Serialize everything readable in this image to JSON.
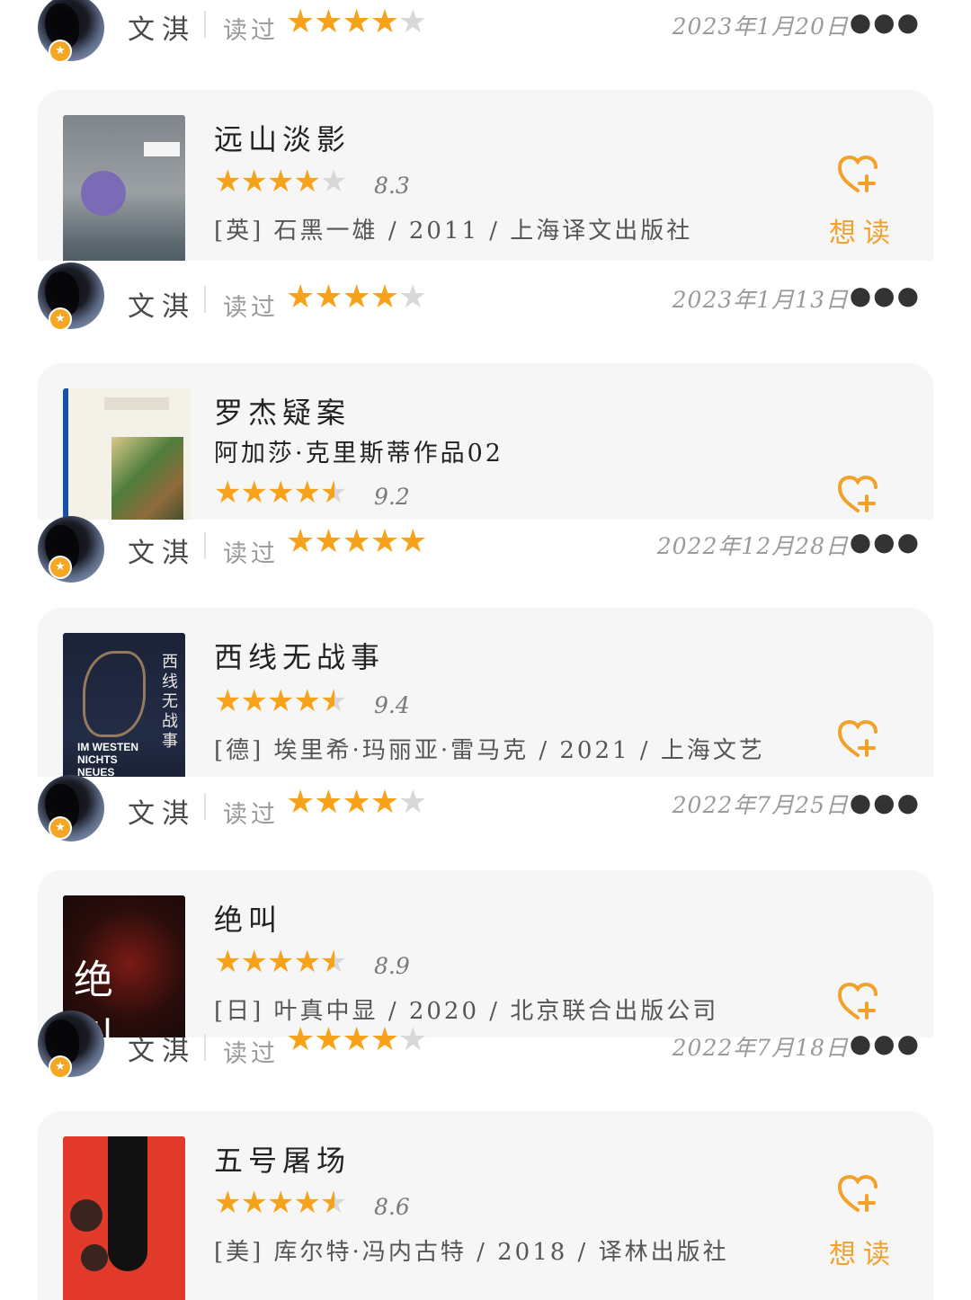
{
  "accent_color": "#f7a21b",
  "entries": [
    {
      "user": "文淇",
      "status": "读过",
      "user_rating": 4,
      "date": "2023年1月20日"
    },
    {
      "user": "文淇",
      "status": "读过",
      "user_rating": 4,
      "date": "2023年1月13日"
    },
    {
      "user": "文淇",
      "status": "读过",
      "user_rating": 5,
      "date": "2022年12月28日"
    },
    {
      "user": "文淇",
      "status": "读过",
      "user_rating": 4,
      "date": "2022年7月25日"
    },
    {
      "user": "文淇",
      "status": "读过",
      "user_rating": 4,
      "date": "2022年7月18日"
    }
  ],
  "books": [
    {
      "title": "远山淡影",
      "rating": 4,
      "score": "8.3",
      "info": "[英] 石黑一雄 / 2011 / 上海译文出版社",
      "wishlist_label": "想读"
    },
    {
      "title": "罗杰疑案",
      "subtitle": "阿加莎·克里斯蒂作品02",
      "rating": 4.5,
      "score": "9.2"
    },
    {
      "title": "西线无战事",
      "rating": 4.5,
      "score": "9.4",
      "info": "[德] 埃里希·玛丽亚·雷马克 / 2021 / 上海文艺"
    },
    {
      "title": "绝叫",
      "rating": 4.5,
      "score": "8.9",
      "info": "[日] 叶真中显 / 2020 / 北京联合出版公司"
    },
    {
      "title": "五号屠场",
      "rating": 4.5,
      "score": "8.6",
      "info": "[美] 库尔特·冯内古特 / 2018 / 译林出版社",
      "wishlist_label": "想读"
    }
  ],
  "icons": {
    "more": "more-dots-icon",
    "wishlist": "heart-plus-icon",
    "vip": "star-badge-icon"
  }
}
